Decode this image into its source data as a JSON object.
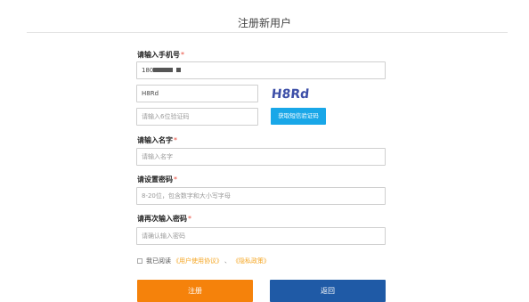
{
  "page_title": "注册新用户",
  "phone": {
    "label": "请输入手机号",
    "required_mark": "*",
    "value": "180"
  },
  "captcha": {
    "value": "H8Rd",
    "image_text": "H8Rd"
  },
  "sms": {
    "placeholder": "请输入6位验证码",
    "button_label": "获取短信验证码"
  },
  "name": {
    "label": "请输入名字",
    "required_mark": "*",
    "placeholder": "请输入名字"
  },
  "password": {
    "label": "请设置密码",
    "required_mark": "*",
    "placeholder": "8-20位，包含数字和大小写字母"
  },
  "confirm_password": {
    "label": "请再次输入密码",
    "required_mark": "*",
    "placeholder": "请确认输入密码"
  },
  "agreement": {
    "prefix": "我已阅读",
    "link_terms": "《用户使用协议》",
    "separator": "、",
    "link_privacy": "《隐私政策》"
  },
  "buttons": {
    "register": "注册",
    "back": "返回"
  },
  "colors": {
    "register_button": "#f5820b",
    "back_button": "#1f5aa6",
    "sms_button": "#19a7e8",
    "link": "#f5a623",
    "required_star": "#e84c3d"
  }
}
